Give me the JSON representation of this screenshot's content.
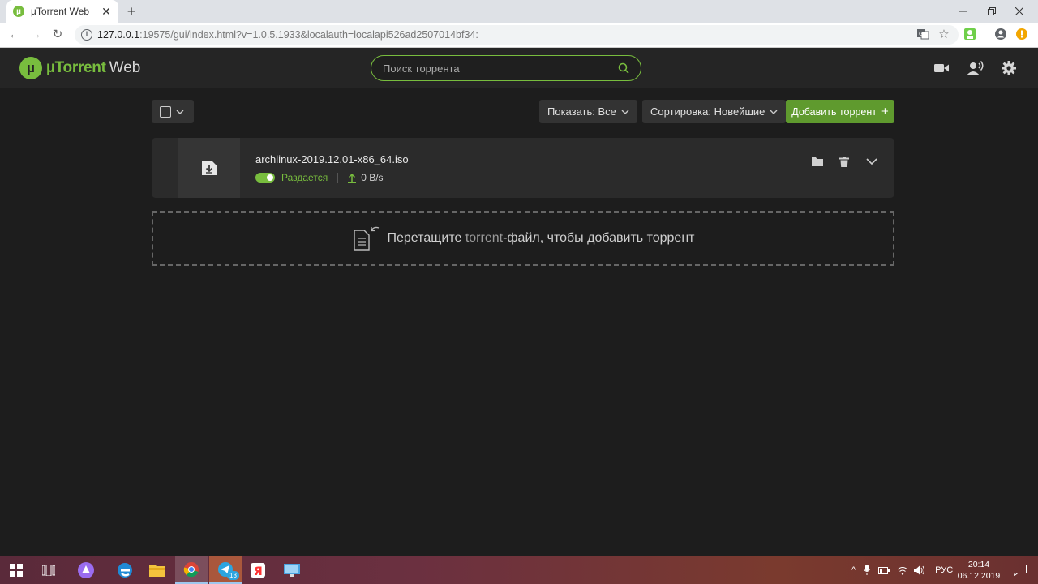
{
  "browser": {
    "tab_title": "µTorrent Web",
    "url_host": "127.0.0.1",
    "url_rest": ":19575/gui/index.html?v=1.0.5.1933&localauth=localapi526ad2507014bf34:"
  },
  "app": {
    "logo_brand": "µTorrent",
    "logo_web": "Web",
    "search_placeholder": "Поиск торрента",
    "accent_color": "#78bd3e"
  },
  "toolbar": {
    "show_label": "Показать: Все",
    "sort_label": "Сортировка: Новейшие",
    "add_label": "Добавить торрент"
  },
  "torrents": [
    {
      "name": "archlinux-2019.12.01-x86_64.iso",
      "status": "Раздается",
      "upload_speed": "0 B/s",
      "enabled": true
    }
  ],
  "dropzone": {
    "text_before": "Перетащите ",
    "text_highlight": "torrent",
    "text_after": "-файл, чтобы добавить торрент"
  },
  "taskbar": {
    "telegram_badge": "13",
    "lang": "РУС",
    "time": "20:14",
    "date": "06.12.2019"
  }
}
